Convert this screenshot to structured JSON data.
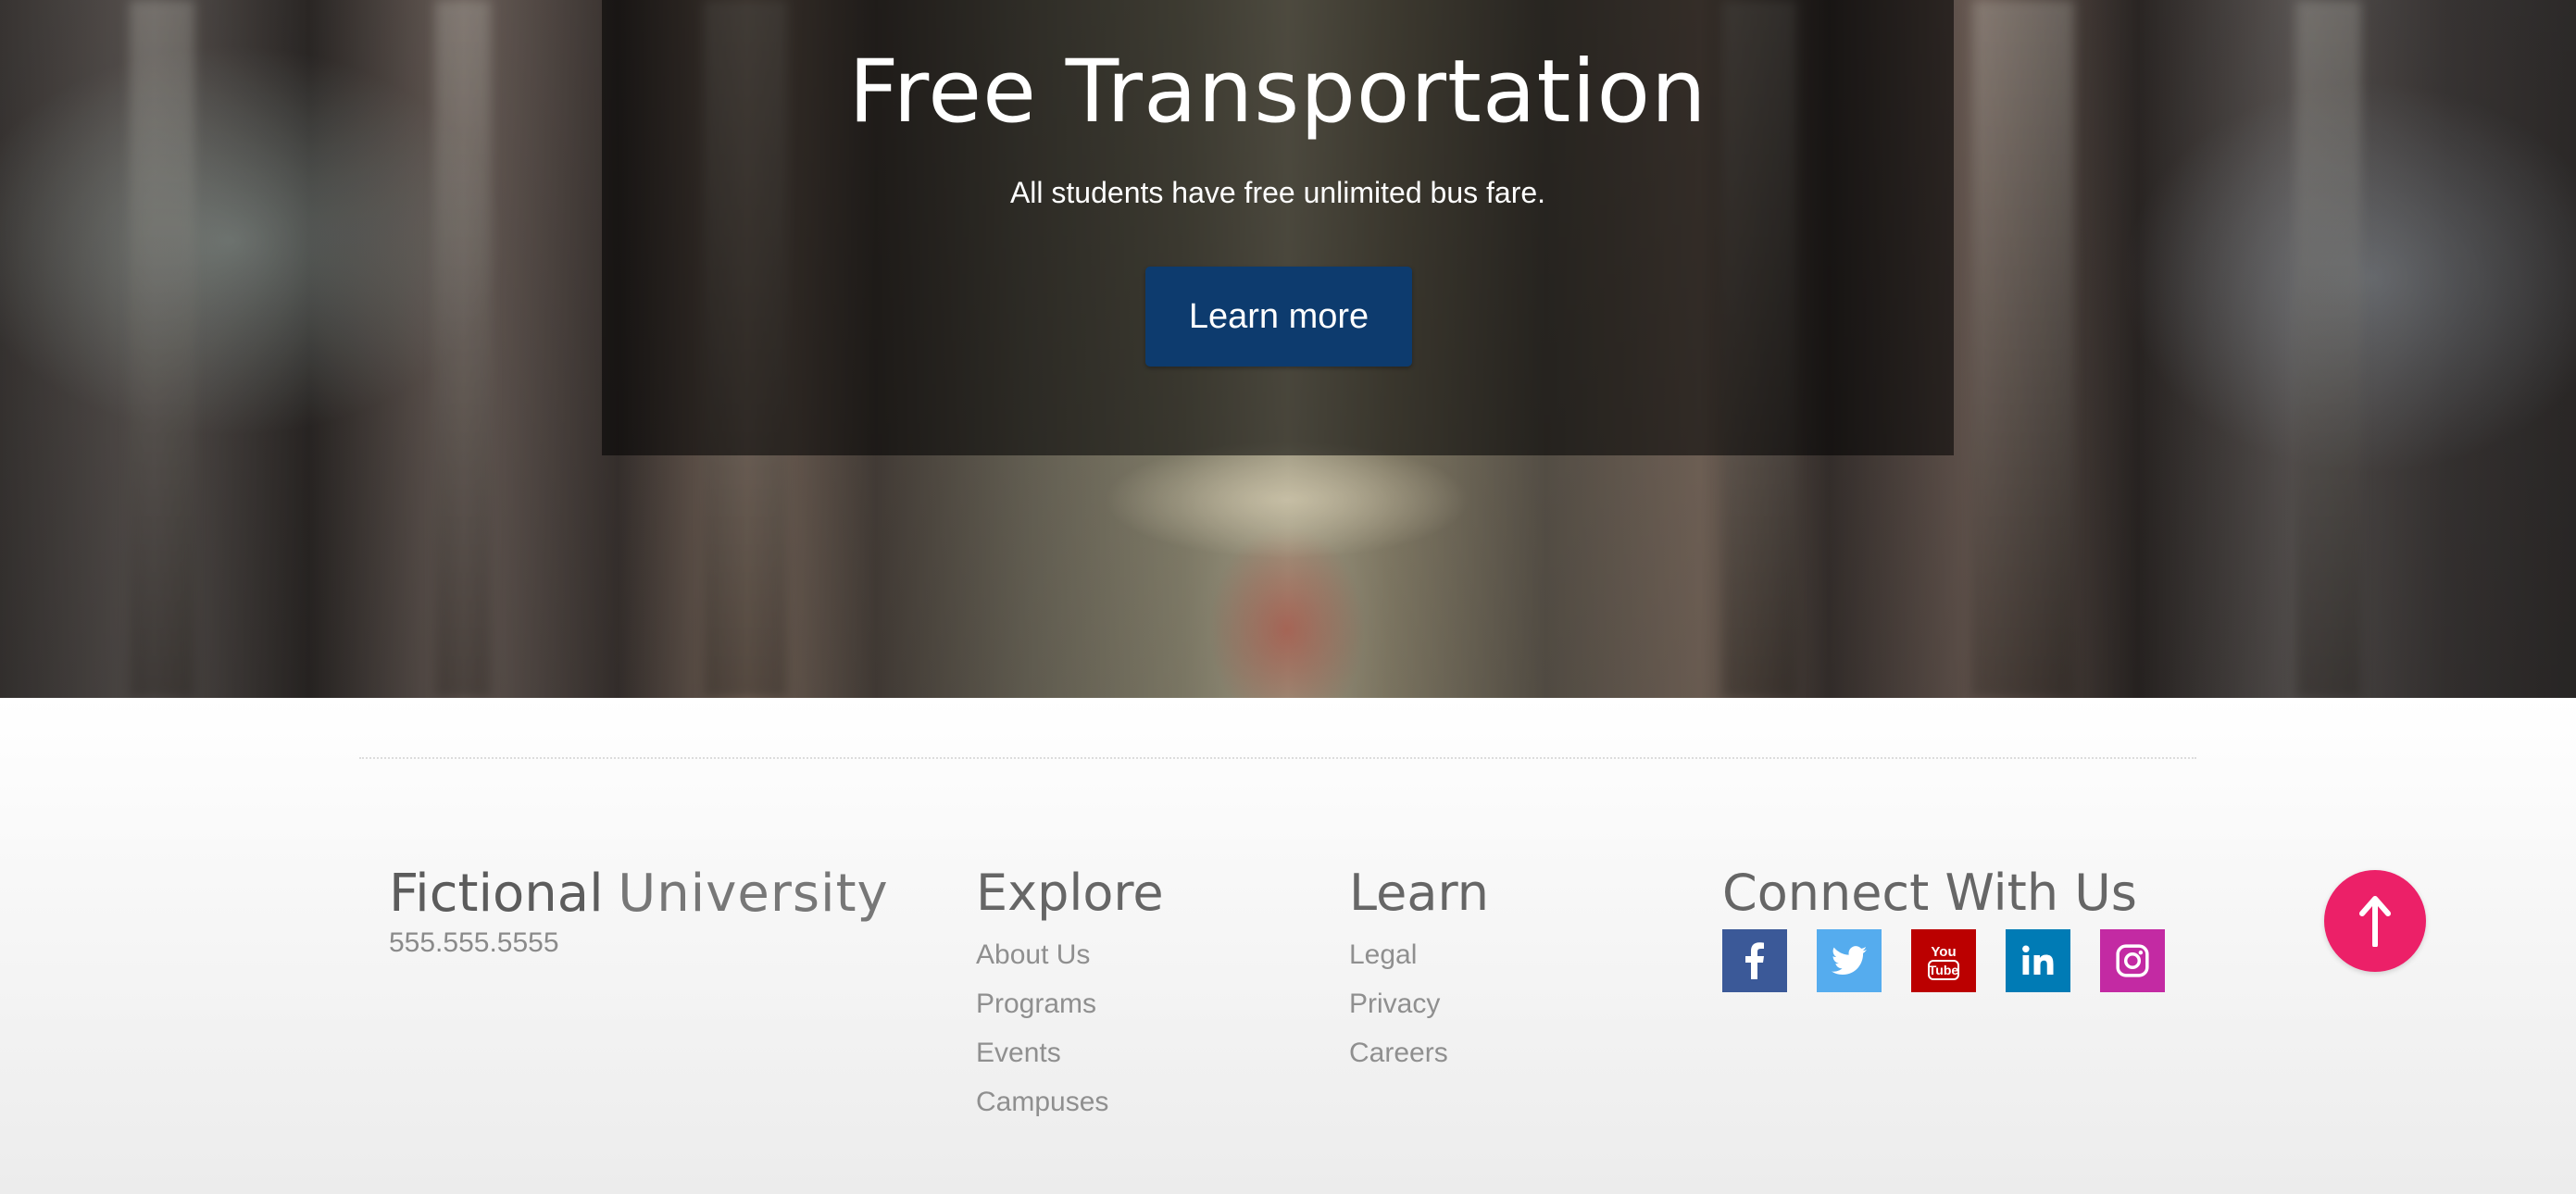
{
  "hero": {
    "title": "Free Transportation",
    "subtitle": "All students have free unlimited bus fare.",
    "button_label": "Learn more",
    "button_color": "#0d3b6e"
  },
  "footer": {
    "brand_bold": "Fictional",
    "brand_light": "University",
    "phone": "555.555.5555",
    "explore": {
      "title": "Explore",
      "links": [
        "About Us",
        "Programs",
        "Events",
        "Campuses"
      ]
    },
    "learn": {
      "title": "Learn",
      "links": [
        "Legal",
        "Privacy",
        "Careers"
      ]
    },
    "connect": {
      "title": "Connect With Us",
      "social": [
        {
          "icon": "facebook-icon",
          "color": "#3b5998"
        },
        {
          "icon": "twitter-icon",
          "color": "#55acee"
        },
        {
          "icon": "youtube-icon",
          "color": "#bb0000"
        },
        {
          "icon": "linkedin-icon",
          "color": "#007bb5"
        },
        {
          "icon": "instagram-icon",
          "color": "#c32aa3"
        }
      ]
    },
    "back_to_top": {
      "icon": "arrow-up-icon",
      "color": "#ec2068"
    }
  }
}
